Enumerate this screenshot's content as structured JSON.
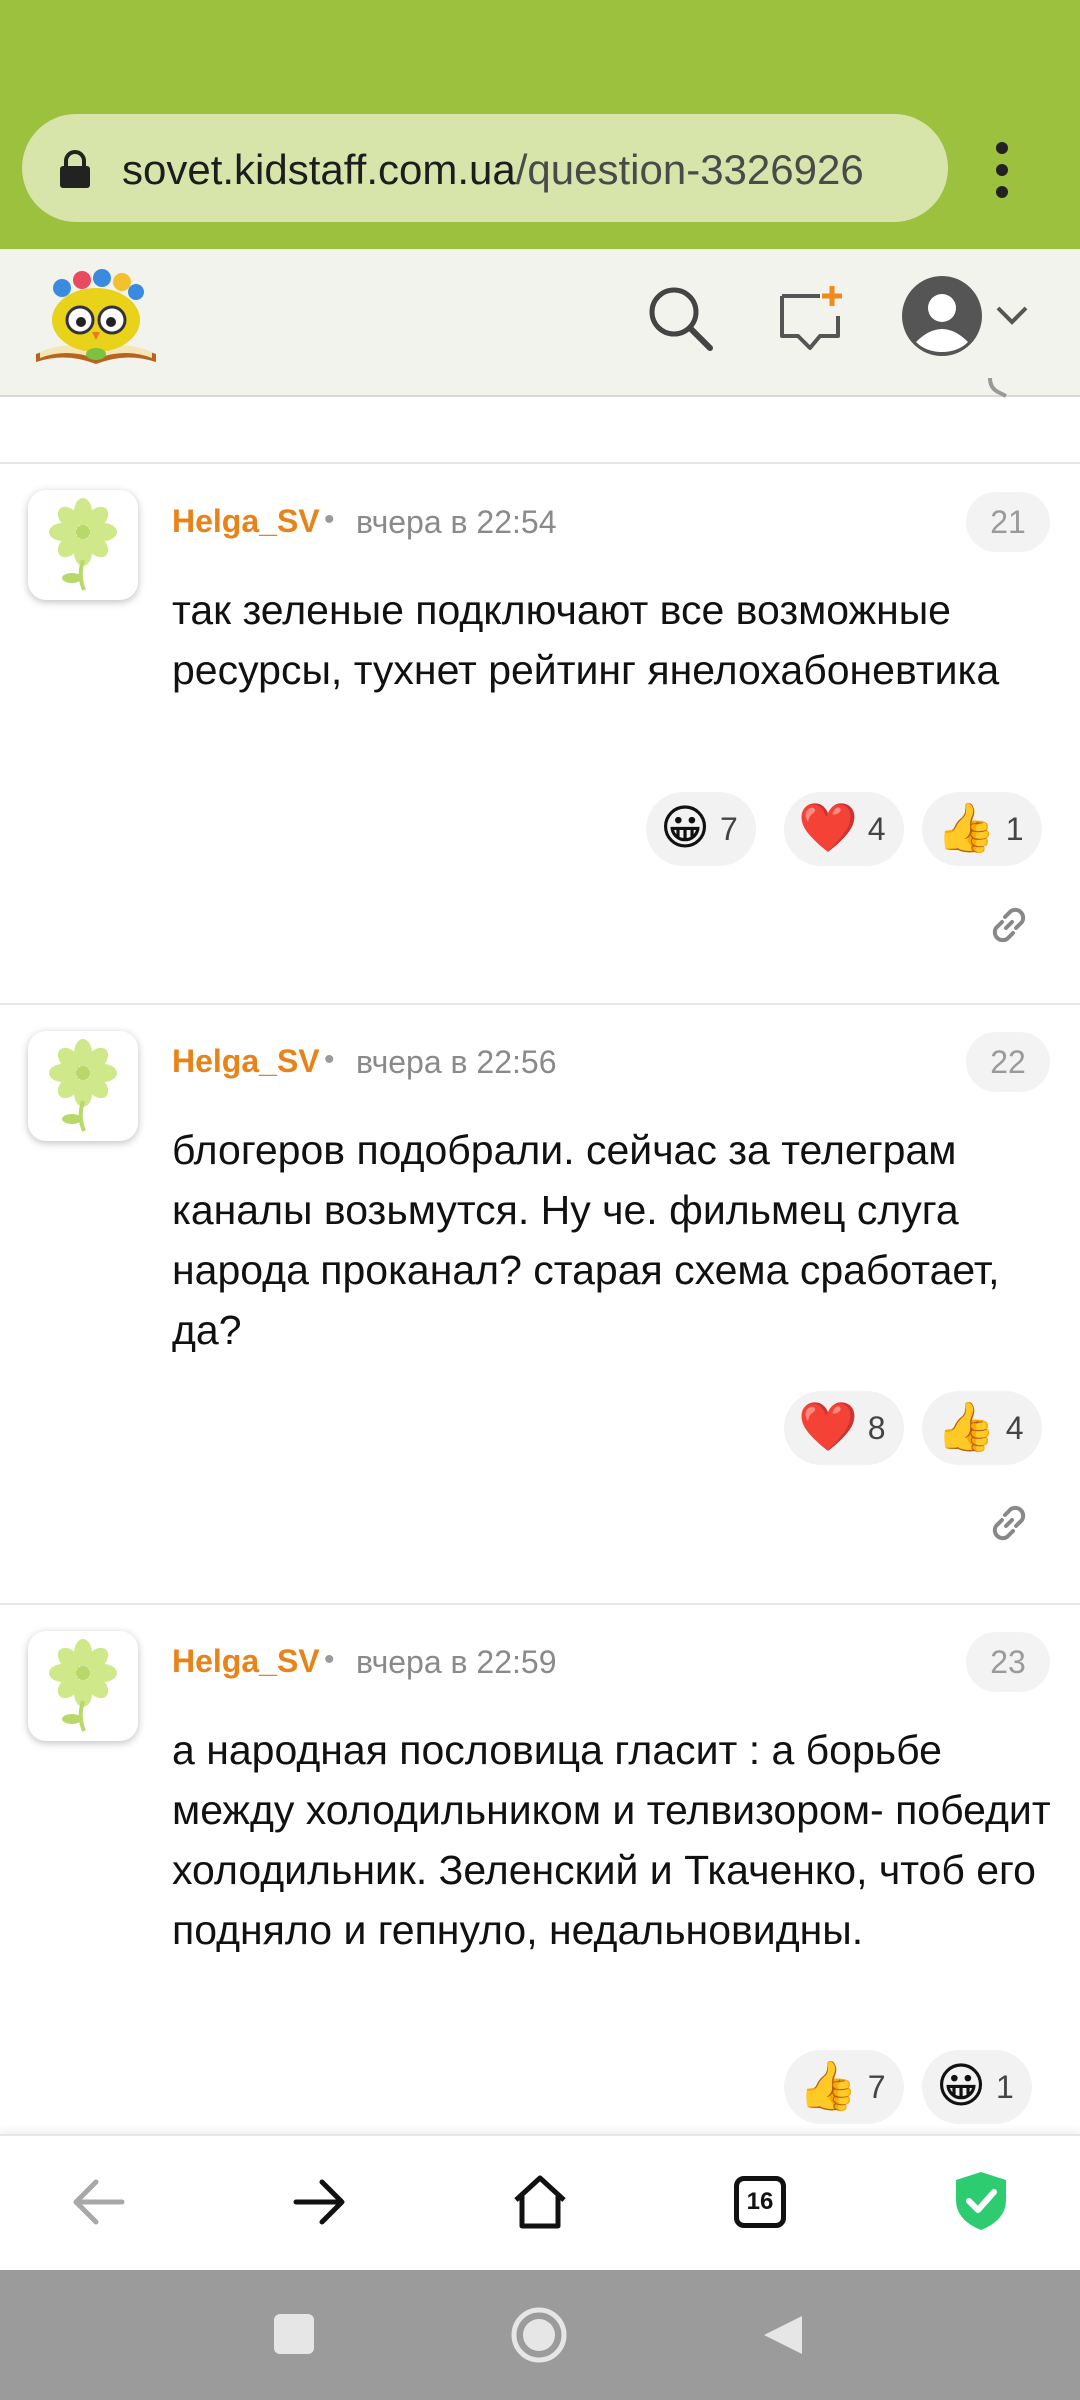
{
  "browser": {
    "url_domain": "sovet.kidstaff.com.ua",
    "url_path": "/question-3326926",
    "tabs_count": "16"
  },
  "site": {
    "logo_icon": "kidstaff-owl-logo",
    "icons": [
      "search-icon",
      "new-question-icon",
      "user-avatar-icon",
      "chevron-down-icon"
    ]
  },
  "comments": [
    {
      "author": "Helga_SV",
      "separator": "•",
      "time": "вчера в 22:54",
      "number": "21",
      "text": "так зеленые подключают все возможные ресурсы, тухнет рейтинг янелохабоневтика",
      "reactions": [
        {
          "emoji": "😀",
          "count": "7"
        },
        {
          "emoji": "❤️",
          "count": "4"
        },
        {
          "emoji": "👍",
          "count": "1"
        }
      ]
    },
    {
      "author": "Helga_SV",
      "separator": "•",
      "time": "вчера в 22:56",
      "number": "22",
      "text": "блогеров подобрали. сейчас за телеграм каналы возьмутся. Ну че. фильмец слуга народа проканал? старая схема сработает, да?",
      "reactions": [
        {
          "emoji": "❤️",
          "count": "8"
        },
        {
          "emoji": "👍",
          "count": "4"
        }
      ]
    },
    {
      "author": "Helga_SV",
      "separator": "•",
      "time": "вчера в 22:59",
      "number": "23",
      "text": "а народная пословица гласит : а борьбе между холодильником и телвизором- победит холодильник. Зеленский и Ткаченко, чтоб его подняло и гепнуло, недальновидны.",
      "reactions": [
        {
          "emoji": "👍",
          "count": "7"
        },
        {
          "emoji": "😀",
          "count": "1"
        }
      ]
    }
  ],
  "colors": {
    "browser_green": "#9cc13f",
    "author_orange": "#e8831a",
    "shield_green": "#2ecc71"
  }
}
